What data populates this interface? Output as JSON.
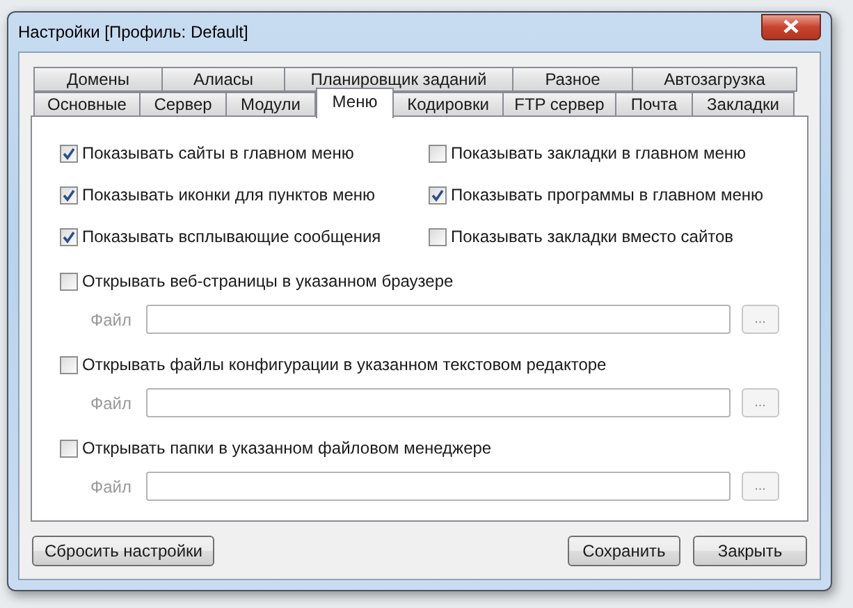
{
  "window": {
    "title": "Настройки [Профиль: Default]"
  },
  "tab_rows": [
    [
      {
        "label": "Домены",
        "selected": false
      },
      {
        "label": "Алиасы",
        "selected": false
      },
      {
        "label": "Планировщик заданий",
        "selected": false
      },
      {
        "label": "Разное",
        "selected": false
      },
      {
        "label": "Автозагрузка",
        "selected": false
      }
    ],
    [
      {
        "label": "Основные",
        "selected": false
      },
      {
        "label": "Сервер",
        "selected": false
      },
      {
        "label": "Модули",
        "selected": false
      },
      {
        "label": "Меню",
        "selected": true
      },
      {
        "label": "Кодировки",
        "selected": false
      },
      {
        "label": "FTP сервер",
        "selected": false
      },
      {
        "label": "Почта",
        "selected": false
      },
      {
        "label": "Закладки",
        "selected": false
      }
    ]
  ],
  "options": [
    {
      "label": "Показывать сайты в главном меню",
      "checked": true
    },
    {
      "label": "Показывать закладки в главном меню",
      "checked": false
    },
    {
      "label": "Показывать иконки для пунктов меню",
      "checked": true
    },
    {
      "label": "Показывать программы в главном меню",
      "checked": true
    },
    {
      "label": "Показывать всплывающие сообщения",
      "checked": true
    },
    {
      "label": "Показывать закладки вместо сайтов",
      "checked": false
    }
  ],
  "path_options": [
    {
      "label": "Открывать веб-страницы в указанном браузере",
      "checked": false,
      "field_label": "Файл",
      "browse": "..."
    },
    {
      "label": "Открывать файлы конфигурации в указанном текстовом редакторе",
      "checked": false,
      "field_label": "Файл",
      "browse": "..."
    },
    {
      "label": "Открывать папки в указанном файловом менеджере",
      "checked": false,
      "field_label": "Файл",
      "browse": "..."
    }
  ],
  "buttons": {
    "reset": "Сбросить настройки",
    "save": "Сохранить",
    "close": "Закрыть"
  }
}
